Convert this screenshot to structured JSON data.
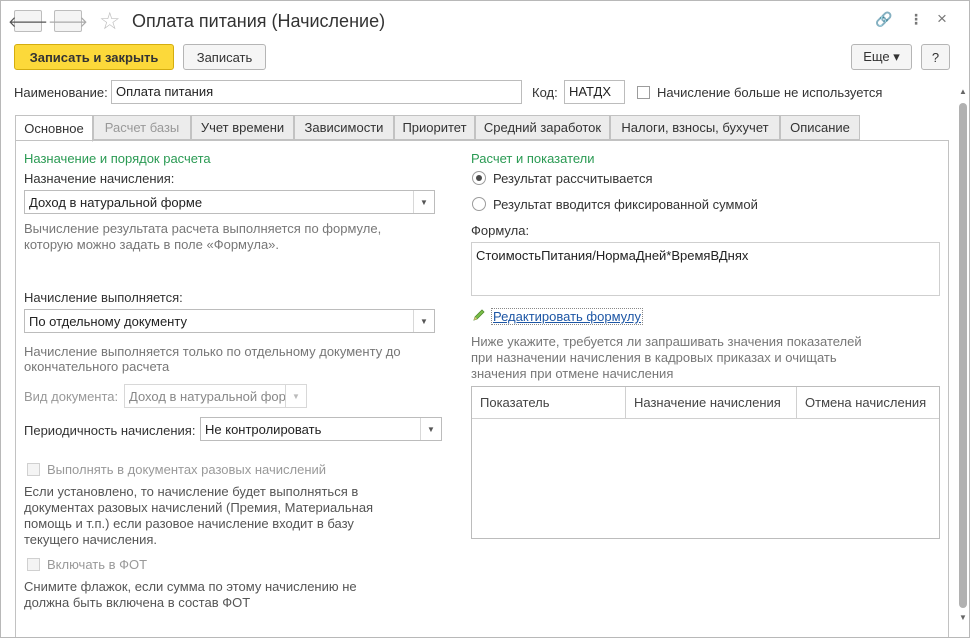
{
  "window": {
    "title": "Оплата питания (Начисление)",
    "back_glyph": "🡐",
    "forward_glyph": "🡒",
    "star_glyph": "☆",
    "link_glyph": "🔗",
    "menu_glyph": "⋮",
    "close_glyph": "×"
  },
  "toolbar": {
    "save_close_label": "Записать и закрыть",
    "save_label": "Записать",
    "more_label": "Еще ▾",
    "help_label": "?"
  },
  "header": {
    "name_label": "Наименование:",
    "name_value": "Оплата питания",
    "code_label": "Код:",
    "code_value": "НАТДХ",
    "unused_label": "Начисление больше не используется"
  },
  "tabs": [
    {
      "label": "Основное"
    },
    {
      "label": "Расчет базы"
    },
    {
      "label": "Учет времени"
    },
    {
      "label": "Зависимости"
    },
    {
      "label": "Приоритет"
    },
    {
      "label": "Средний заработок"
    },
    {
      "label": "Налоги, взносы, бухучет"
    },
    {
      "label": "Описание"
    }
  ],
  "left": {
    "section_title": "Назначение и порядок расчета",
    "purpose_label": "Назначение начисления:",
    "purpose_value": "Доход в натуральной форме",
    "purpose_hint_1": "Вычисление результата расчета выполняется по формуле,",
    "purpose_hint_2": "которую можно задать в поле «Формула».",
    "executed_label": "Начисление выполняется:",
    "executed_value": "По отдельному документу",
    "executed_hint_1": "Начисление выполняется только по отдельному документу до",
    "executed_hint_2": "окончательного расчета",
    "doc_type_label": "Вид документа:",
    "doc_type_value": "Доход в натуральной фор",
    "periodicity_label": "Периодичность начисления:",
    "periodicity_value": "Не контролировать",
    "one_time_label": "Выполнять в документах разовых начислений",
    "one_time_hint_1": "Если установлено, то начисление будет выполняться в",
    "one_time_hint_2": "документах разовых начислений (Премия, Материальная",
    "one_time_hint_3": "помощь и т.п.) если разовое начисление входит в базу",
    "one_time_hint_4": "текущего начисления.",
    "fot_label": "Включать в ФОТ",
    "fot_hint_1": "Снимите флажок, если сумма по этому начислению не",
    "fot_hint_2": "должна быть включена в состав ФОТ"
  },
  "right": {
    "section_title": "Расчет и показатели",
    "radio_calculated": "Результат рассчитывается",
    "radio_fixed": "Результат вводится фиксированной суммой",
    "formula_label": "Формула:",
    "formula_value": "СтоимостьПитания/НормаДней*ВремяВДнях",
    "edit_formula_link": "Редактировать формулу",
    "indicators_hint_1": "Ниже укажите, требуется ли запрашивать значения показателей",
    "indicators_hint_2": "при назначении начисления в кадровых приказах и очищать",
    "indicators_hint_3": "значения при отмене начисления",
    "table_headers": [
      "Показатель",
      "Назначение начисления",
      "Отмена начисления"
    ]
  }
}
